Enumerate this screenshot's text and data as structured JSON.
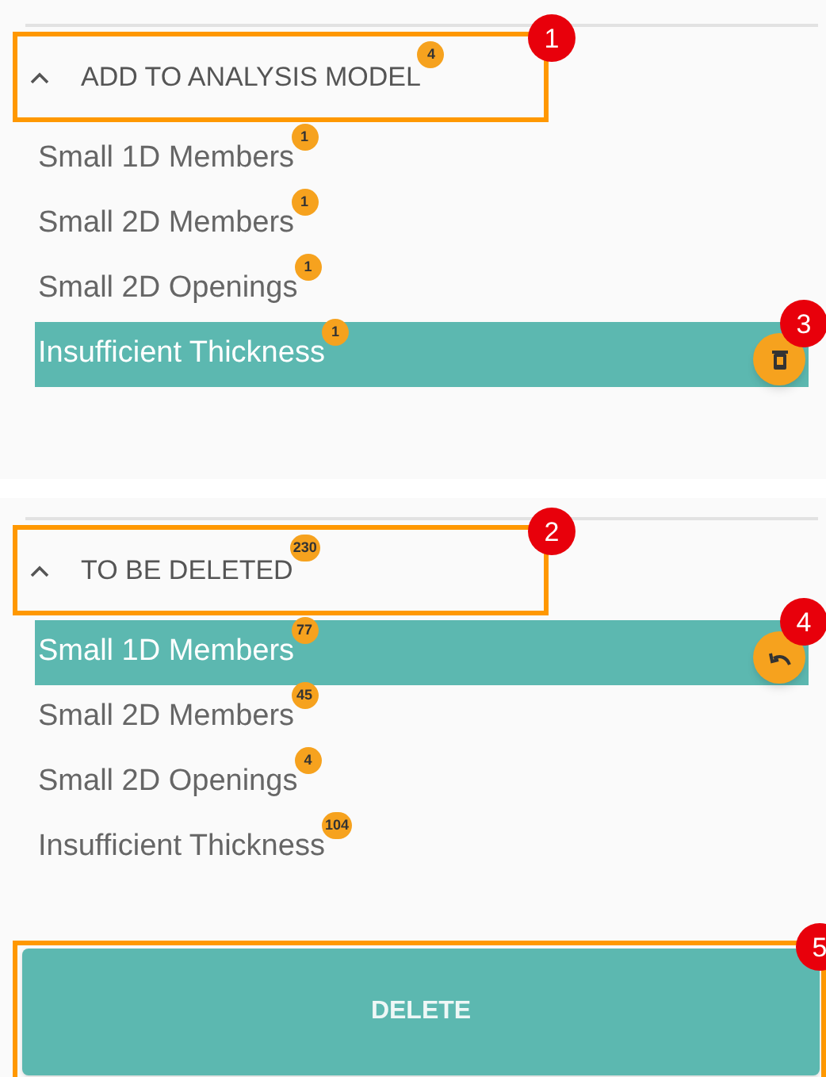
{
  "sections": [
    {
      "title": "ADD TO ANALYSIS MODEL",
      "count": "4",
      "expanded": true,
      "callout": "1",
      "items": [
        {
          "label": "Small 1D Members",
          "count": "1",
          "selected": false
        },
        {
          "label": "Small 2D Members",
          "count": "1",
          "selected": false
        },
        {
          "label": "Small 2D Openings",
          "count": "1",
          "selected": false
        },
        {
          "label": "Insufficient Thickness",
          "count": "1",
          "selected": true,
          "action": {
            "kind": "delete",
            "callout": "3"
          }
        }
      ]
    },
    {
      "title": "TO BE DELETED",
      "count": "230",
      "expanded": true,
      "callout": "2",
      "items": [
        {
          "label": "Small 1D Members",
          "count": "77",
          "selected": true,
          "action": {
            "kind": "undo",
            "callout": "4"
          }
        },
        {
          "label": "Small 2D Members",
          "count": "45",
          "selected": false
        },
        {
          "label": "Small 2D Openings",
          "count": "4",
          "selected": false
        },
        {
          "label": "Insufficient Thickness",
          "count": "104",
          "selected": false
        }
      ]
    }
  ],
  "delete_button": {
    "label": "DELETE",
    "callout": "5"
  }
}
